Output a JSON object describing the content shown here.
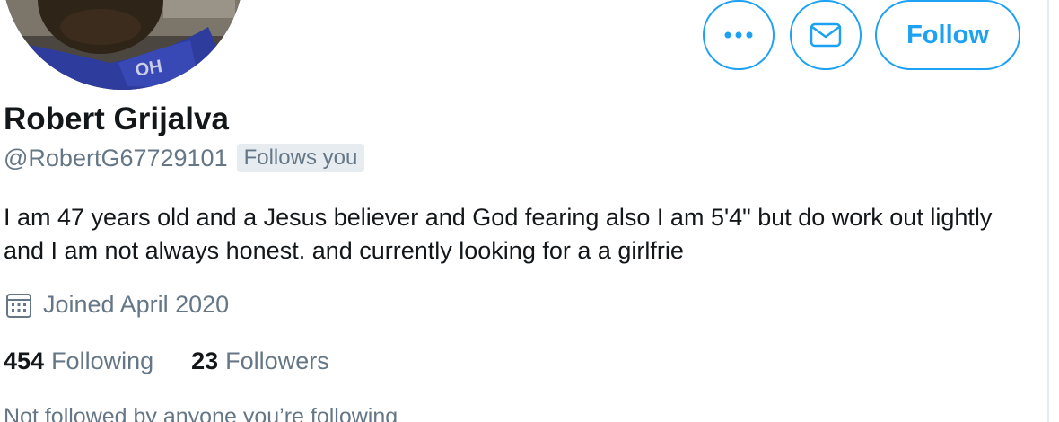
{
  "profile": {
    "name": "Robert Grijalva",
    "handle": "@RobertG67729101",
    "follows_you_badge": "Follows you",
    "bio": "I am 47 years old and a Jesus believer and God fearing also I am 5'4\" but do work out lightly and I am not always honest. and currently looking for a a girlfrie",
    "joined": "Joined April 2020",
    "following_count": "454",
    "following_label": "Following",
    "followers_count": "23",
    "followers_label": "Followers",
    "mutuals_note": "Not followed by anyone you’re following"
  },
  "actions": {
    "follow_label": "Follow",
    "more_icon": "more-horizontal-icon",
    "message_icon": "envelope-icon"
  },
  "colors": {
    "accent": "#1da1f2",
    "text_primary": "#14171a",
    "text_secondary": "#657786",
    "badge_bg": "#e6ecf0"
  },
  "icons": {
    "joined": "calendar-icon"
  }
}
